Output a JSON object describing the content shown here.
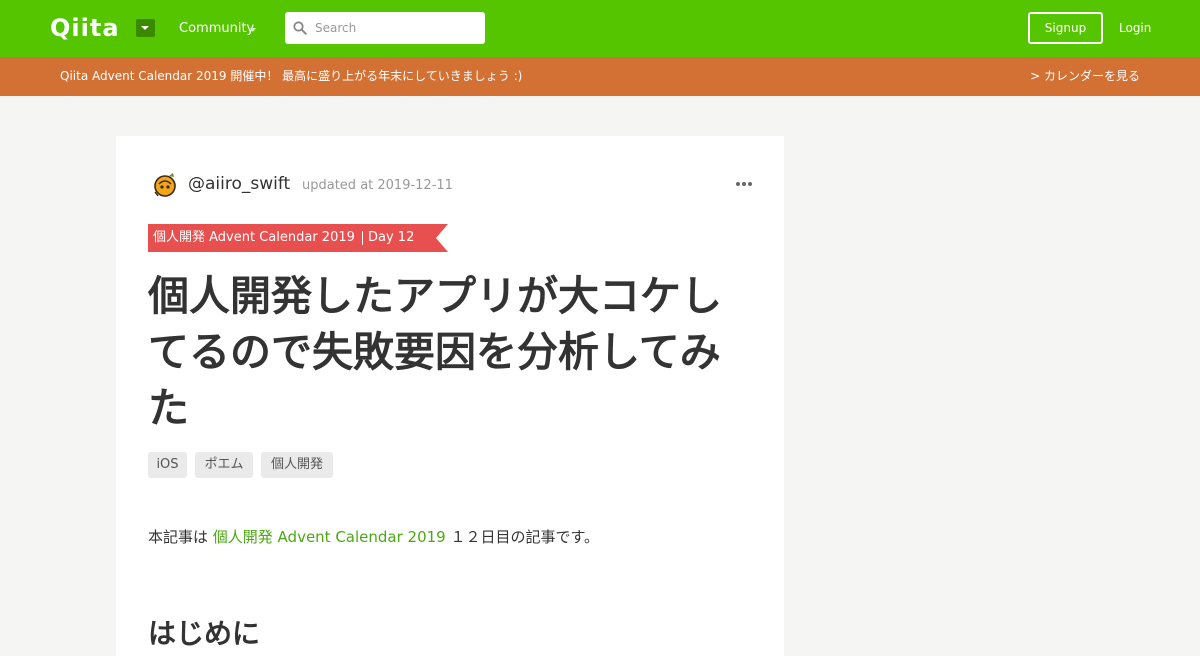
{
  "header": {
    "logo": "Qiita",
    "community_label": "Community",
    "search_placeholder": "Search",
    "signup_label": "Signup",
    "login_label": "Login"
  },
  "banner": {
    "text": "Qiita Advent Calendar 2019 開催中！ 最高に盛り上がる年末にしていきましょう :)",
    "link": "> カレンダーを見る"
  },
  "article": {
    "username": "@aiiro_swift",
    "updated": "updated at 2019-12-11",
    "calendar_name": "個人開発 Advent Calendar 2019",
    "calendar_day": "Day 12",
    "title": "個人開発したアプリが大コケしてるので失敗要因を分析してみた",
    "tags": [
      "iOS",
      "ポエム",
      "個人開発"
    ],
    "intro_prefix": "本記事は ",
    "intro_link": "個人開発 Advent Calendar 2019",
    "intro_suffix": " １２日目の記事です。",
    "next_heading": "はじめに"
  },
  "colors": {
    "header_green": "#55c500",
    "banner_orange": "#d37134",
    "ribbon_red": "#e85050",
    "link_green": "#4ca813"
  }
}
